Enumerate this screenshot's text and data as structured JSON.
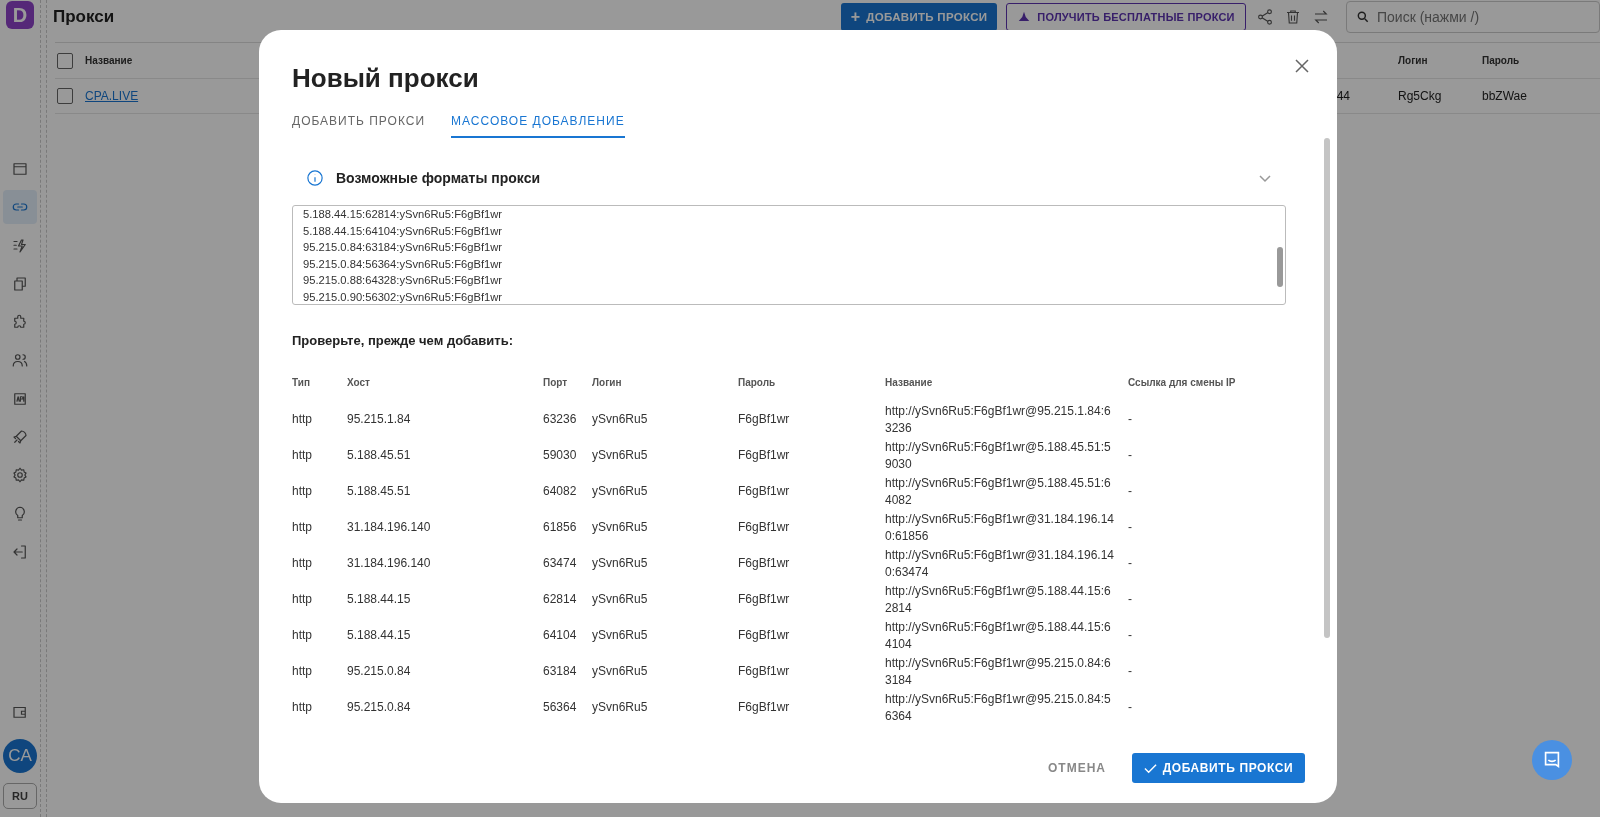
{
  "logo": "D",
  "page": {
    "title": "Прокси"
  },
  "toolbar": {
    "add_button": {
      "icon": "+",
      "label": "ДОБАВИТЬ ПРОКСИ"
    },
    "free_button": "ПОЛУЧИТЬ БЕСПЛАТНЫЕ ПРОКСИ",
    "search": {
      "placeholder": "Поиск (нажми /)"
    }
  },
  "sidebar": {
    "items": [
      {
        "selected": false
      },
      {
        "selected": true
      },
      {
        "selected": false
      },
      {
        "selected": false
      },
      {
        "selected": false
      },
      {
        "selected": false
      },
      {
        "selected": false
      },
      {
        "selected": false
      },
      {
        "selected": false
      },
      {
        "selected": false
      },
      {
        "selected": false
      }
    ],
    "avatar": "CA",
    "language": "RU"
  },
  "table": {
    "header_checked": false,
    "columns": [
      "Название",
      "Логин",
      "Пароль"
    ],
    "rows": [
      {
        "checked": false,
        "name": "CPA.LIVE",
        "column_2": "44",
        "login": "Rg5Ckg",
        "password": "bbZWae"
      }
    ]
  },
  "dialog": {
    "title": "Новый прокси",
    "tabs": [
      {
        "label": "ДОБАВИТЬ ПРОКСИ",
        "selected": false
      },
      {
        "label": "МАССОВОЕ ДОБАВЛЕНИЕ",
        "selected": true
      }
    ],
    "accordion": {
      "title": "Возможные форматы прокси",
      "expanded": false
    },
    "textarea": {
      "lines": [
        "5.188.44.15:62814:ySvn6Ru5:F6gBf1wr",
        "5.188.44.15:64104:ySvn6Ru5:F6gBf1wr",
        "95.215.0.84:63184:ySvn6Ru5:F6gBf1wr",
        "95.215.0.84:56364:ySvn6Ru5:F6gBf1wr",
        "95.215.0.88:64328:ySvn6Ru5:F6gBf1wr",
        "95.215.0.90:56302:ySvn6Ru5:F6gBf1wr"
      ]
    },
    "check_title": "Проверьте, прежде чем добавить:",
    "columns": [
      "Тип",
      "Хост",
      "Порт",
      "Логин",
      "Пароль",
      "Название",
      "Ссылка для смены IP"
    ],
    "rows": [
      [
        "http",
        "95.215.1.84",
        "63236",
        "ySvn6Ru5",
        "F6gBf1wr",
        "http://ySvn6Ru5:F6gBf1wr@95.215.1.84:63236",
        "-"
      ],
      [
        "http",
        "5.188.45.51",
        "59030",
        "ySvn6Ru5",
        "F6gBf1wr",
        "http://ySvn6Ru5:F6gBf1wr@5.188.45.51:59030",
        "-"
      ],
      [
        "http",
        "5.188.45.51",
        "64082",
        "ySvn6Ru5",
        "F6gBf1wr",
        "http://ySvn6Ru5:F6gBf1wr@5.188.45.51:64082",
        "-"
      ],
      [
        "http",
        "31.184.196.140",
        "61856",
        "ySvn6Ru5",
        "F6gBf1wr",
        "http://ySvn6Ru5:F6gBf1wr@31.184.196.140:61856",
        "-"
      ],
      [
        "http",
        "31.184.196.140",
        "63474",
        "ySvn6Ru5",
        "F6gBf1wr",
        "http://ySvn6Ru5:F6gBf1wr@31.184.196.140:63474",
        "-"
      ],
      [
        "http",
        "5.188.44.15",
        "62814",
        "ySvn6Ru5",
        "F6gBf1wr",
        "http://ySvn6Ru5:F6gBf1wr@5.188.44.15:62814",
        "-"
      ],
      [
        "http",
        "5.188.44.15",
        "64104",
        "ySvn6Ru5",
        "F6gBf1wr",
        "http://ySvn6Ru5:F6gBf1wr@5.188.44.15:64104",
        "-"
      ],
      [
        "http",
        "95.215.0.84",
        "63184",
        "ySvn6Ru5",
        "F6gBf1wr",
        "http://ySvn6Ru5:F6gBf1wr@95.215.0.84:63184",
        "-"
      ],
      [
        "http",
        "95.215.0.84",
        "56364",
        "ySvn6Ru5",
        "F6gBf1wr",
        "http://ySvn6Ru5:F6gBf1wr@95.215.0.84:56364",
        "-"
      ]
    ],
    "cancel_button": "ОТМЕНА",
    "submit_button": "ДОБАВИТЬ ПРОКСИ"
  }
}
